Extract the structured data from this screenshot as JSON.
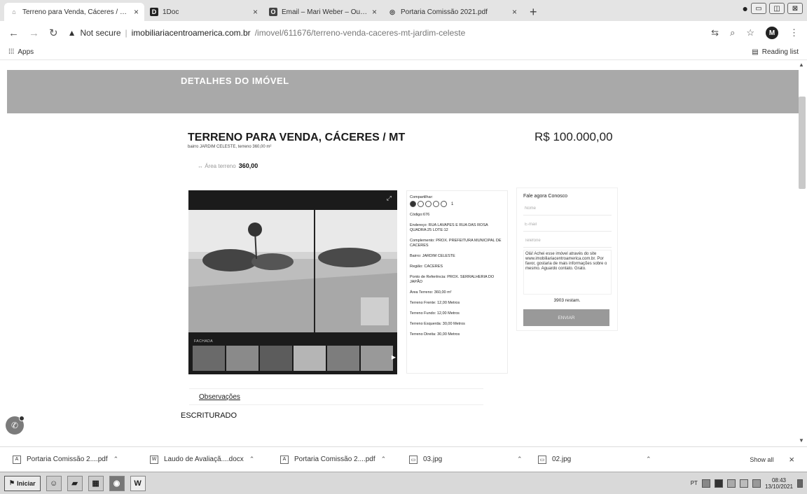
{
  "browser": {
    "tabs": [
      {
        "title": "Terreno para Venda, Cáceres / MT, ...",
        "fav": "⌂",
        "active": true
      },
      {
        "title": "1Doc",
        "fav": "D",
        "active": false
      },
      {
        "title": "Email – Mari Weber – Outlook",
        "fav": "O",
        "active": false
      },
      {
        "title": "Portaria Comissão 2021.pdf",
        "fav": "◎",
        "active": false
      }
    ],
    "new_tab": "+",
    "security_label": "Not secure",
    "url_host": "imobiliariacentroamerica.com.br",
    "url_path": "/imovel/611676/terreno-venda-caceres-mt-jardim-celeste",
    "profile_initial": "M",
    "bookmarks_apps": "Apps",
    "reading_list": "Reading list"
  },
  "page": {
    "hero_title": "DETALHES DO IMÓVEL",
    "title": "TERRENO PARA VENDA, CÁCERES / MT",
    "subtitle": "bairro JARDIM CELESTE, terreno 360,00 m²",
    "price": "R$ 100.000,00",
    "area_label": "↔ Área terreno",
    "area_value": "360,00",
    "photo_caption": "FACHADA",
    "share_label": "Compartilhar:",
    "share_count": "1",
    "details": [
      "Código:676",
      "Endereço: RUA LAVAPES E RUA DAS ROSA QUADRA:25 LOTE:12",
      "Complemento: PROX. PREFEITURA MUNICIPAL DE CACERES",
      "Bairro: JARDIM CELESTE",
      "Região: CACERES",
      "Ponto de Referência: PROX. SERRALHERIA DO JAPÃO",
      "Área Terreno: 360,00 m²",
      "Terreno Frente: 12,00 Metros",
      "Terreno Fundo: 12,00 Metros",
      "Terreno Esquerda: 30,00 Metros",
      "Terreno Direita: 30,00 Metros"
    ],
    "contact": {
      "title": "Fale agora Conosco",
      "name_placeholder": "Nome",
      "email_placeholder": "E-mail",
      "phone_placeholder": "Telefone",
      "message": "Olá! Achei esse imóvel através do site www.imobiliariacentroamerica.com.br. Por favor, gostaria de mais informações sobre o mesmo. Aguardo contato. Grato.",
      "remaining": "3903 restam.",
      "send_label": "ENVIAR"
    },
    "obs_tab": "Observações",
    "obs_text": "ESCRITURADO"
  },
  "downloads": {
    "items": [
      {
        "name": "Portaria Comissão 2....pdf",
        "icon": "pdf-icon"
      },
      {
        "name": "Laudo de Avaliaçã....docx",
        "icon": "docx-icon"
      },
      {
        "name": "Portaria Comissão 2....pdf",
        "icon": "pdf-icon"
      },
      {
        "name": "03.jpg",
        "icon": "image-icon"
      },
      {
        "name": "02.jpg",
        "icon": "image-icon"
      }
    ],
    "show_all": "Show all"
  },
  "taskbar": {
    "start_label": "Iniciar",
    "lang": "PT",
    "time": "08:43",
    "date": "13/10/2021"
  }
}
